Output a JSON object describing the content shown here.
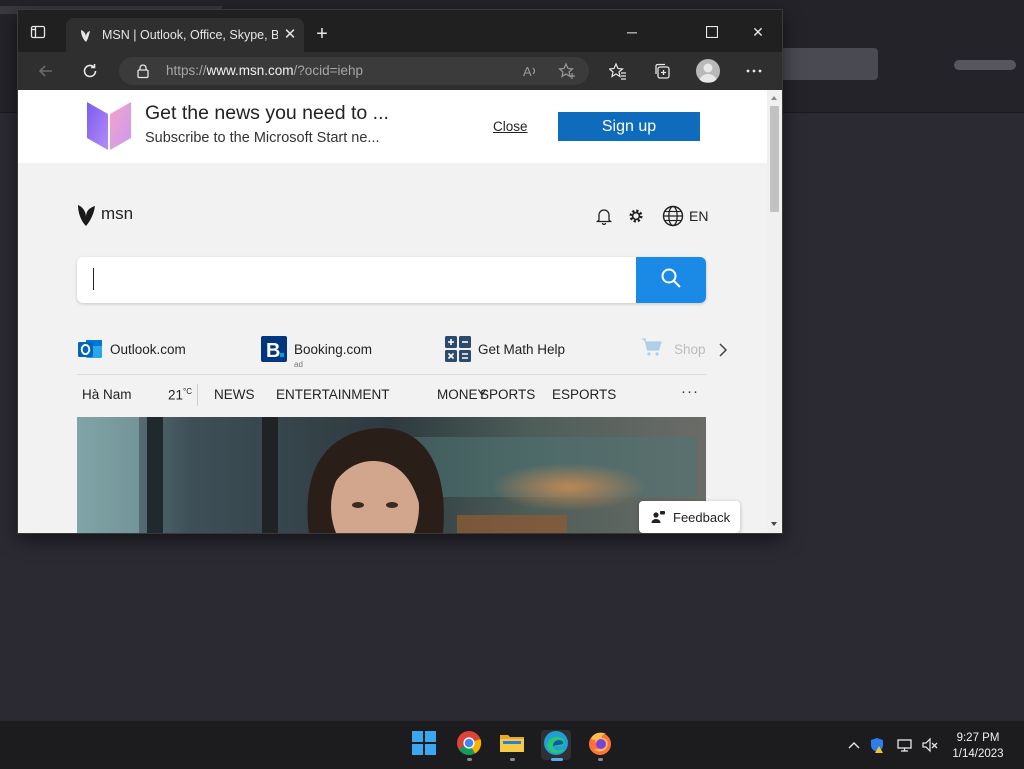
{
  "browser": {
    "tab_title": "MSN | Outlook, Office, Skype, Bing",
    "url_prefix": "https://",
    "url_host": "www.msn.com",
    "url_rest": "/?ocid=iehp"
  },
  "promo": {
    "title": "Get the news you need to ...",
    "subtitle": "Subscribe to the Microsoft Start ne...",
    "close_label": "Close",
    "signup_label": "Sign up"
  },
  "msn": {
    "logo_text": "msn",
    "language": "EN"
  },
  "quick_links": [
    {
      "label": "Outlook.com",
      "icon": "outlook-icon"
    },
    {
      "label": "Booking.com",
      "sub": "ad",
      "icon": "booking-icon"
    },
    {
      "label": "Get Math Help",
      "icon": "calculator-icon"
    },
    {
      "label": "Shop",
      "icon": "cart-icon"
    }
  ],
  "nav": {
    "location": "Hà Nam",
    "temperature": "21",
    "temp_unit": "°C",
    "items": [
      "NEWS",
      "ENTERTAINMENT",
      "MONEY",
      "SPORTS",
      "ESPORTS"
    ],
    "more": "···"
  },
  "feedback_label": "Feedback",
  "clock": {
    "time": "9:27 PM",
    "date": "1/14/2023"
  },
  "colors": {
    "signup_blue": "#0f6cbd",
    "search_blue": "#1b8ae6",
    "edge_active": "#5aa9f0"
  }
}
